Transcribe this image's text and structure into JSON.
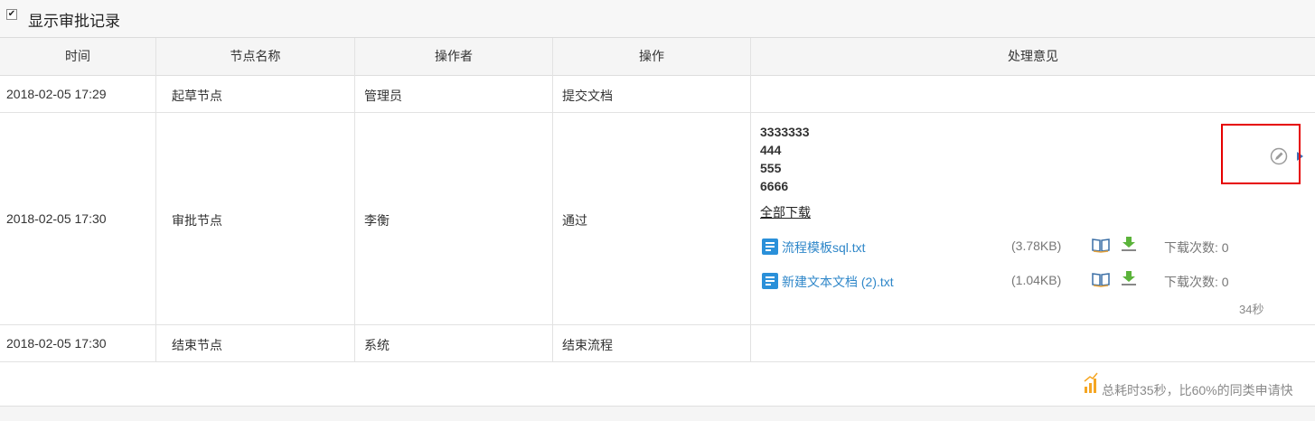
{
  "header": {
    "checkbox_checked": true,
    "title": "显示审批记录"
  },
  "table": {
    "columns": [
      "时间",
      "节点名称",
      "操作者",
      "操作",
      "处理意见"
    ],
    "rows": [
      {
        "time": "2018-02-05 17:29",
        "node": "起草节点",
        "operator": "管理员",
        "action": "提交文档"
      },
      {
        "time": "2018-02-05 17:30",
        "node": "审批节点",
        "operator": "李衡",
        "action": "通过"
      },
      {
        "time": "2018-02-05 17:30",
        "node": "结束节点",
        "operator": "系统",
        "action": "结束流程"
      }
    ],
    "opinion": {
      "lines": [
        "3333333",
        "444",
        "555",
        "6666"
      ],
      "download_all": "全部下载",
      "attachments": [
        {
          "name": "流程模板sql.txt",
          "size": "(3.78KB)",
          "download_count": "下载次数: 0"
        },
        {
          "name": "新建文本文档 (2).txt",
          "size": "(1.04KB)",
          "download_count": "下载次数: 0"
        }
      ],
      "elapsed": "34秒"
    }
  },
  "summary": "总耗时35秒，比60%的同类申请快",
  "colors": {
    "accent": "#2f87c9",
    "highlight_box": "#e60000",
    "download_icon": "#5bb33a",
    "chart_icon": "#f5a623"
  },
  "icons": [
    "checkbox-icon",
    "file-icon",
    "preview-book-icon",
    "download-icon",
    "edit-icon",
    "bar-chart-icon"
  ]
}
